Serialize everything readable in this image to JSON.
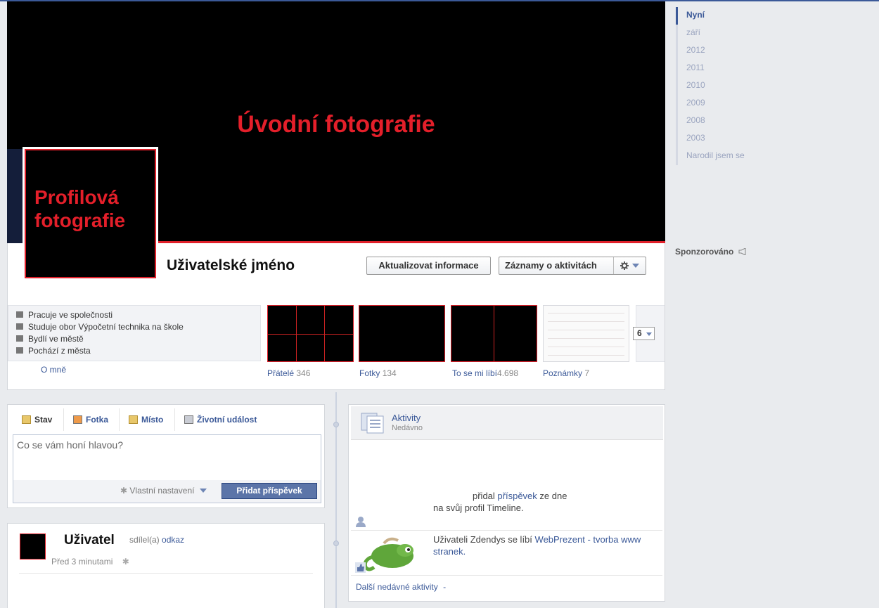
{
  "cover": {
    "title": "Úvodní fotografie"
  },
  "profile": {
    "picture_text": "Profilová fotografie",
    "username": "Uživatelské jméno",
    "update_button": "Aktualizovat informace",
    "activity_button": "Záznamy o aktivitách"
  },
  "info": {
    "rows": [
      {
        "text": "Pracuje ve společnosti",
        "icon": "briefcase-icon"
      },
      {
        "text": "Studuje obor Výpočetní technika na škole",
        "icon": "graduation-cap-icon"
      },
      {
        "text": "Bydlí ve městě",
        "icon": "city-icon"
      },
      {
        "text": "Pochází z města",
        "icon": "house-icon"
      }
    ],
    "about_link": "O mně"
  },
  "tiles": [
    {
      "label": "Přátelé",
      "count": "346"
    },
    {
      "label": "Fotky",
      "count": "134"
    },
    {
      "label": "To se mi líbí",
      "count": "4.698"
    },
    {
      "label": "Poznámky",
      "count": "7"
    }
  ],
  "more_button": "6",
  "composer": {
    "tabs": [
      "Stav",
      "Fotka",
      "Místo",
      "Životní událost"
    ],
    "placeholder": "Co se vám honí hlavou?",
    "privacy": "Vlastní nastavení",
    "post_button": "Přidat příspěvek"
  },
  "story": {
    "name": "Uživatel",
    "action": "sdílel(a)",
    "object": "odkaz",
    "time": "Před 3 minutami"
  },
  "activity": {
    "title": "Aktivity",
    "subtitle": "Nedávno",
    "item1_pre": "přidal",
    "item1_link": "příspěvek",
    "item1_post": "ze dne",
    "item1_line2": "na svůj profil Timeline.",
    "item2_pre": "Uživateli Zdendys se líbí",
    "item2_link": "WebPrezent - tvorba www stranek.",
    "more": "Další nedávné aktivity",
    "more_dash": "-"
  },
  "years": [
    "Nyní",
    "září",
    "2012",
    "2011",
    "2010",
    "2009",
    "2008",
    "2003",
    "Narodil jsem se"
  ],
  "sponsored": "Sponzorováno",
  "colors": {
    "brand": "#3b5998",
    "accent_red": "#e41f2a"
  }
}
